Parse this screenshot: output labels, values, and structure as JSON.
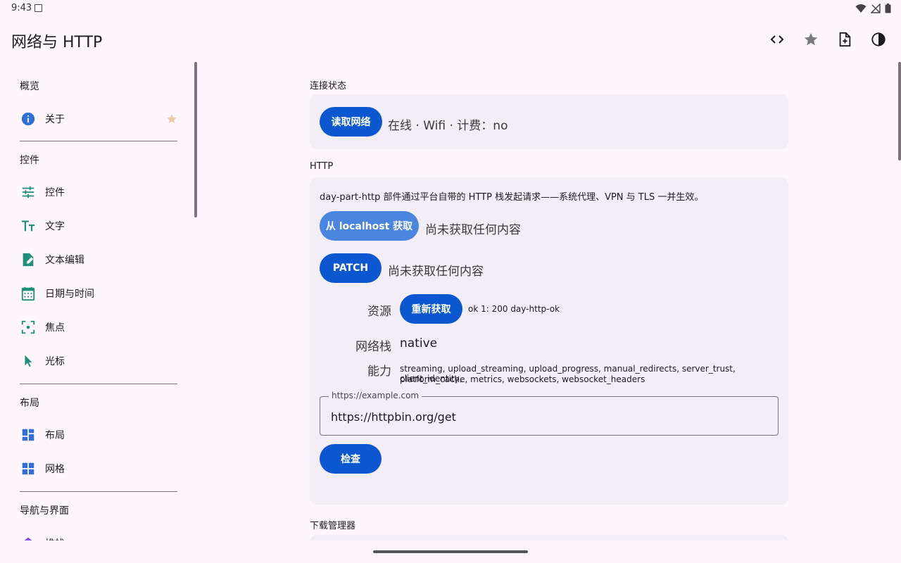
{
  "status": {
    "time": "9:43"
  },
  "app": {
    "title": "网络与 HTTP"
  },
  "toolbar": {
    "actions": [
      {
        "icon": "code-icon",
        "label": ""
      },
      {
        "icon": "star-icon",
        "label": ""
      },
      {
        "icon": "note-add-icon",
        "label": ""
      },
      {
        "icon": "contrast-icon",
        "label": ""
      }
    ]
  },
  "sidebar": {
    "sections": [
      {
        "title": "概览",
        "items": [
          {
            "label": "关于",
            "icon": "info-icon",
            "starred": true
          }
        ]
      },
      {
        "title": "控件",
        "items": [
          {
            "label": "控件",
            "icon": "tune-icon"
          },
          {
            "label": "文字",
            "icon": "text-fields-icon"
          },
          {
            "label": "文本编辑",
            "icon": "edit-note-icon"
          },
          {
            "label": "日期与时间",
            "icon": "calendar-icon"
          },
          {
            "label": "焦点",
            "icon": "center-focus-icon"
          },
          {
            "label": "光标",
            "icon": "cursor-icon"
          }
        ]
      },
      {
        "title": "布局",
        "items": [
          {
            "label": "布局",
            "icon": "dashboard-icon"
          },
          {
            "label": "网格",
            "icon": "grid-icon"
          }
        ]
      },
      {
        "title": "导航与界面",
        "items": [
          {
            "label": "堆栈",
            "icon": "layers-icon"
          }
        ]
      }
    ]
  },
  "main": {
    "connection": {
      "title": "连接状态",
      "button": "读取网络",
      "status": "在线 · Wifi · 计费：no"
    },
    "http": {
      "title": "HTTP",
      "description": "day-part-http 部件通过平台自带的 HTTP 栈发起请求——系统代理、VPN 与 TLS 一并生效。",
      "fetch_button": "从 localhost 获取",
      "fetch_result": "尚未获取任何内容",
      "patch_button": "PATCH",
      "patch_result": "尚未获取任何内容",
      "resource_label": "资源",
      "refetch_button": "重新获取",
      "resource_value": "ok 1: 200 day-http-ok",
      "stack_label": "网络栈",
      "stack_value": "native",
      "capabilities_label": "能力",
      "capabilities_line1": "streaming, upload_streaming, upload_progress, manual_redirects, server_trust, client_identity,",
      "capabilities_line2": "platform_cache, metrics, websockets, websocket_headers",
      "url_label": "https://example.com",
      "url_value": "https://httpbin.org/get",
      "check_button": "检查"
    },
    "downloads": {
      "title": "下载管理器"
    }
  },
  "colors": {
    "primary": "#0b57d0",
    "primary_light": "#4a86e0",
    "card": "#f3edf5",
    "background": "#fdf7fd",
    "icon_teal": "#1f8f7a",
    "icon_blue": "#2f6fd6"
  }
}
